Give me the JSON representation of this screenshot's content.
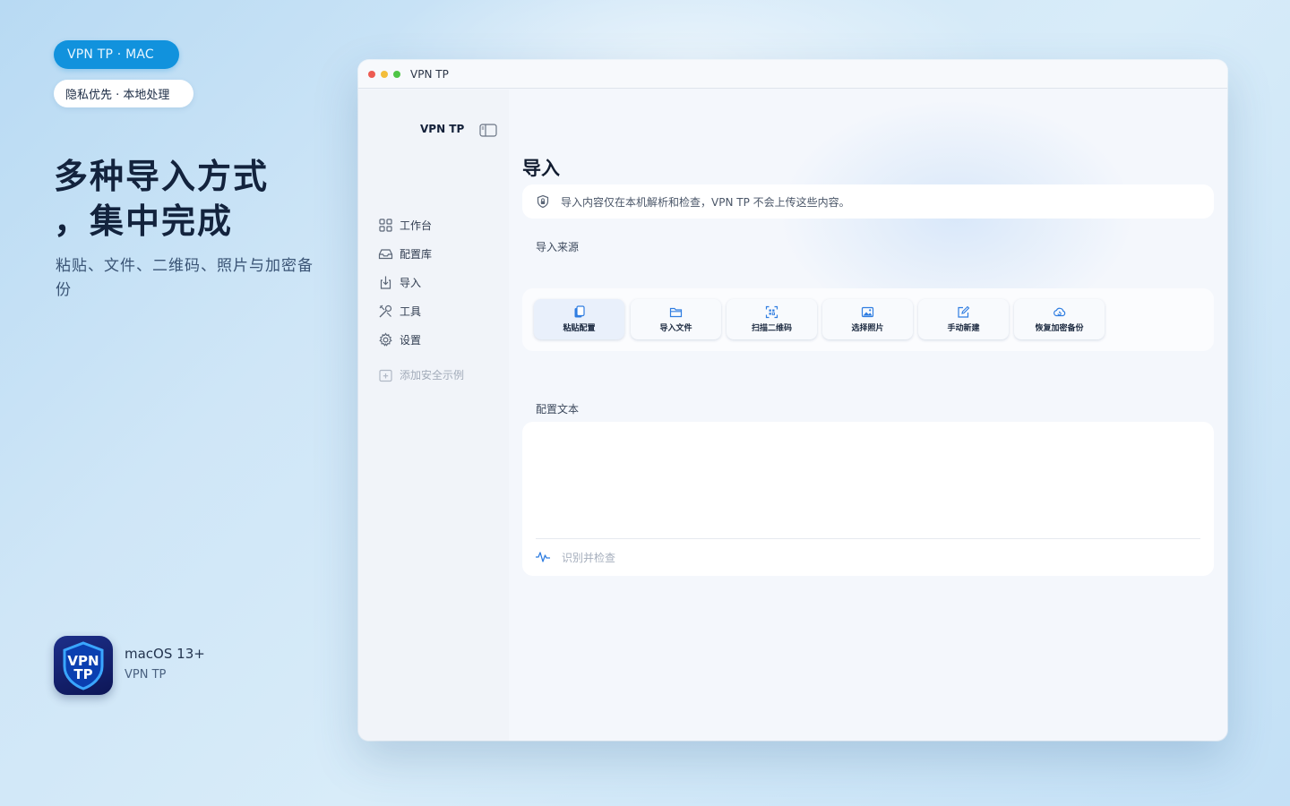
{
  "promo": {
    "badge": "VPN TP ·  MAC",
    "tag": "隐私优先 ·  本地处理",
    "headline_line1": "多种导入方式",
    "headline_line2": "，集中完成",
    "subline": "粘贴、文件、二维码、照片与加密备份",
    "platform": "macOS 13+",
    "app_name": "VPN TP",
    "icon_text_top": "VPN",
    "icon_text_bottom": "TP"
  },
  "window": {
    "title": "VPN TP"
  },
  "sidebar": {
    "brand": "VPN TP",
    "items": [
      {
        "label": "工作台",
        "icon": "grid-icon"
      },
      {
        "label": "配置库",
        "icon": "tray-icon"
      },
      {
        "label": "导入",
        "icon": "import-icon"
      },
      {
        "label": "工具",
        "icon": "tools-icon"
      },
      {
        "label": "设置",
        "icon": "gear-icon"
      }
    ],
    "add_sample": "添加安全示例"
  },
  "main": {
    "title": "导入",
    "notice": "导入内容仅在本机解析和检查，VPN TP 不会上传这些内容。",
    "source_label": "导入来源",
    "sources": [
      {
        "label": "粘贴配置",
        "icon": "paste-icon"
      },
      {
        "label": "导入文件",
        "icon": "folder-icon"
      },
      {
        "label": "扫描二维码",
        "icon": "qr-scan-icon"
      },
      {
        "label": "选择照片",
        "icon": "photo-icon"
      },
      {
        "label": "手动新建",
        "icon": "edit-icon"
      },
      {
        "label": "恢复加密备份",
        "icon": "cloud-restore-icon"
      }
    ],
    "text_label": "配置文本",
    "textarea_value": "",
    "check_label": "识别并检查"
  },
  "colors": {
    "accent": "#1192dd",
    "icon_blue": "#2f7de1"
  }
}
